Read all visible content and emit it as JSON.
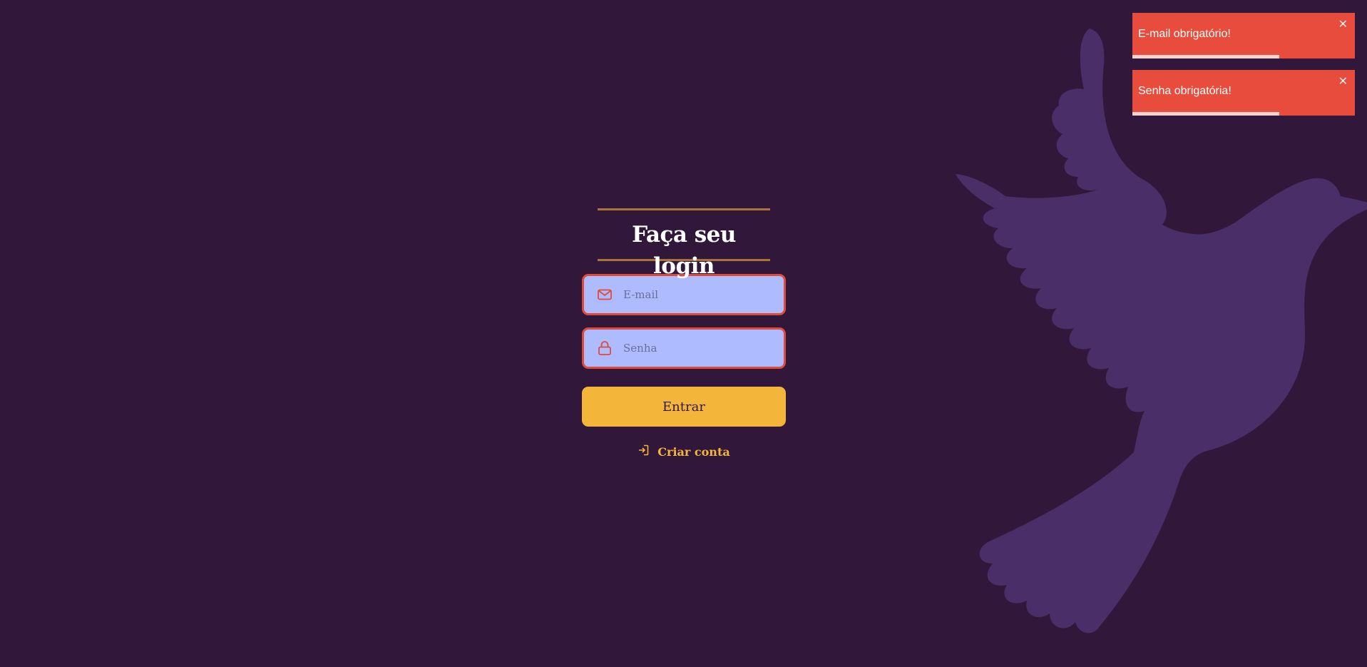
{
  "login": {
    "title": "Faça seu login",
    "email_placeholder": "E-mail",
    "password_placeholder": "Senha",
    "submit_label": "Entrar",
    "create_account_label": "Criar conta",
    "email_icon": "mail-icon",
    "password_icon": "lock-icon",
    "create_account_icon": "log-in-icon"
  },
  "toasts": [
    {
      "message": "E-mail obrigatório!",
      "progress": 0.66,
      "close_icon": "close-icon"
    },
    {
      "message": "Senha obrigatória!",
      "progress": 0.66,
      "close_icon": "close-icon"
    }
  ],
  "colors": {
    "background": "#31183a",
    "accent": "#f4b63a",
    "error": "#e74c3c",
    "input_background": "#aebcff",
    "bird": "#4a2e67"
  }
}
